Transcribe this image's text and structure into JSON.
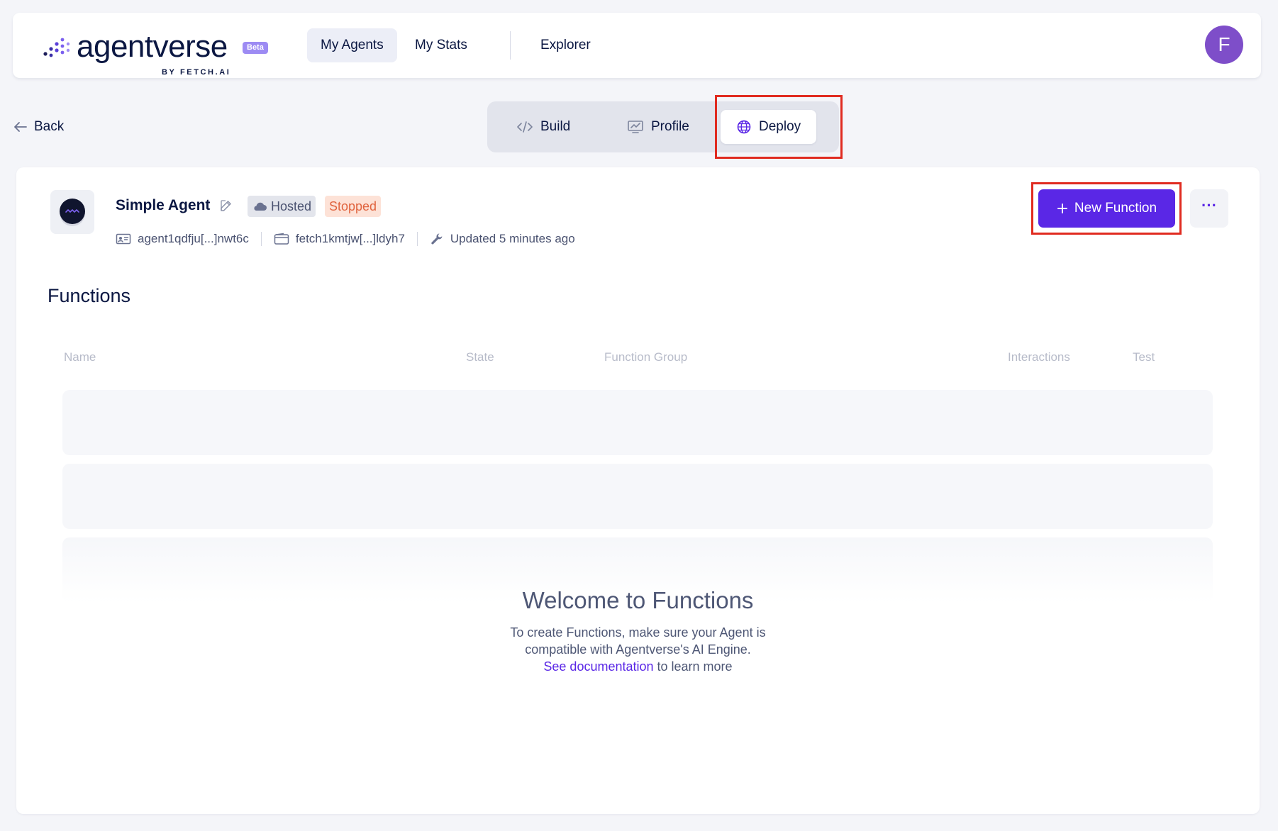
{
  "app": {
    "logo_text": "agentverse",
    "logo_badge": "Beta",
    "logo_byline": "BY FETCH.AI"
  },
  "nav": {
    "items": [
      {
        "label": "My Agents",
        "active": true
      },
      {
        "label": "My Stats",
        "active": false
      },
      {
        "label": "Explorer",
        "active": false
      }
    ],
    "avatar_initial": "F"
  },
  "back_label": "Back",
  "tabs": [
    {
      "label": "Build",
      "icon": "code-icon",
      "active": false
    },
    {
      "label": "Profile",
      "icon": "monitor-chart-icon",
      "active": false
    },
    {
      "label": "Deploy",
      "icon": "globe-icon",
      "active": true
    }
  ],
  "agent": {
    "name": "Simple Agent",
    "hosting_badge": "Hosted",
    "status_badge": "Stopped",
    "address": "agent1qdfju[...]nwt6c",
    "wallet": "fetch1kmtjw[...]ldyh7",
    "updated": "Updated 5 minutes ago"
  },
  "actions": {
    "new_function_label": "New Function",
    "more_label": "···"
  },
  "functions": {
    "title": "Functions",
    "columns": [
      "Name",
      "State",
      "Function Group",
      "Interactions",
      "Test"
    ],
    "empty_title": "Welcome to Functions",
    "empty_line1": "To create Functions, make sure your Agent is",
    "empty_line2": "compatible with Agentverse's AI Engine.",
    "empty_link": "See documentation",
    "empty_link_suffix": " to learn more"
  },
  "colors": {
    "primary": "#5a27e6",
    "highlight_box": "#e02b20",
    "stopped_bg": "#fde2d7",
    "stopped_text": "#e0643f",
    "avatar": "#7e4ec9"
  }
}
